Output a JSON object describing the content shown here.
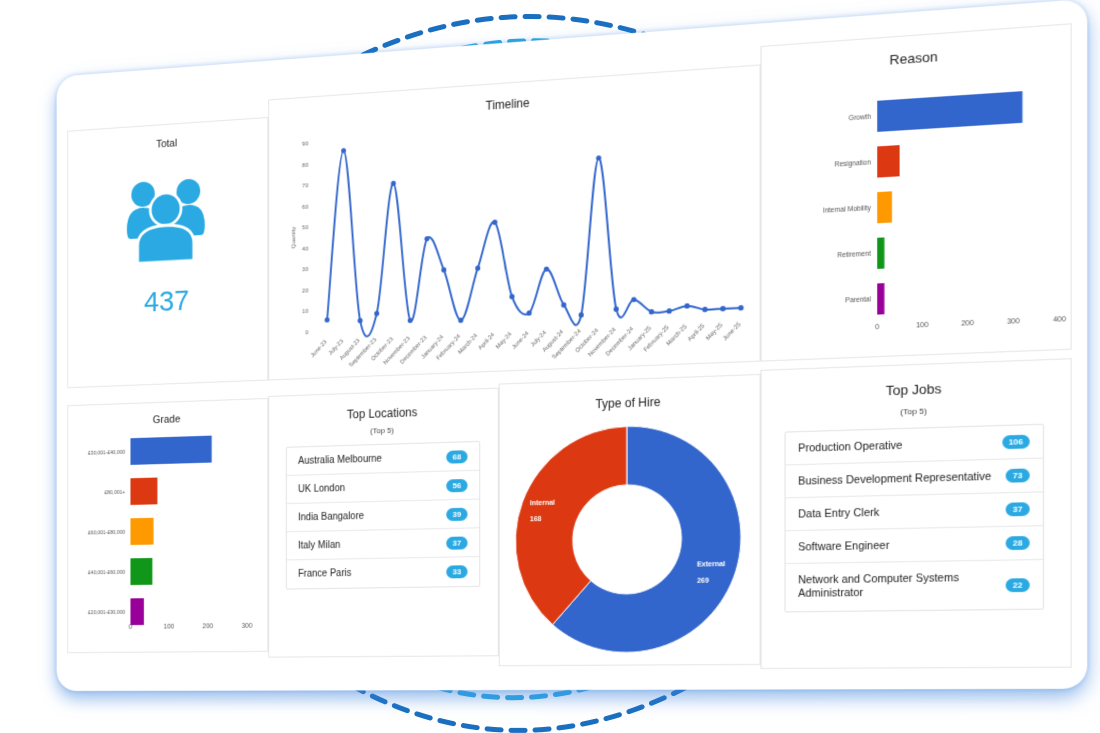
{
  "total": {
    "title": "Total",
    "value": "437",
    "icon": "users-group-icon",
    "color": "#2aa9e2"
  },
  "timeline": {
    "title": "Timeline",
    "chart_data": {
      "type": "line",
      "title": "Timeline",
      "xlabel": "",
      "ylabel": "Quantity",
      "ylim": [
        0,
        90
      ],
      "yticks": [
        0,
        10,
        20,
        30,
        40,
        50,
        60,
        70,
        80,
        90
      ],
      "grid": false,
      "color": "#3366cc",
      "x": [
        "June-23",
        "July-23",
        "August-23",
        "September-23",
        "October-23",
        "November-23",
        "December-23",
        "January-24",
        "February-24",
        "March-24",
        "April-24",
        "May-24",
        "June-24",
        "July-24",
        "August-24",
        "September-24",
        "October-24",
        "November-24",
        "December-24",
        "January-25",
        "February-25",
        "March-25",
        "April-25",
        "May-25",
        "June-25"
      ],
      "values": [
        5,
        85,
        4,
        7,
        68,
        3,
        41,
        26,
        2,
        26,
        47,
        12,
        4,
        24,
        7,
        2,
        74,
        4,
        8,
        2,
        2,
        4,
        2,
        2,
        2
      ]
    }
  },
  "reason": {
    "title": "Reason",
    "chart_data": {
      "type": "bar",
      "orientation": "horizontal",
      "title": "Reason",
      "categories": [
        "Growth",
        "Resignation",
        "Internal Mobility",
        "Retirement",
        "Parental"
      ],
      "values": [
        320,
        50,
        33,
        16,
        16
      ],
      "colors": [
        "#3366cc",
        "#dc3912",
        "#ff9900",
        "#109618",
        "#990099"
      ],
      "xlim": [
        0,
        400
      ],
      "xticks": [
        0,
        100,
        200,
        300,
        400
      ]
    }
  },
  "grade": {
    "title": "Grade",
    "chart_data": {
      "type": "bar",
      "orientation": "horizontal",
      "title": "Grade",
      "categories": [
        "£30,001-£40,000",
        "£80,001+",
        "£60,001-£80,000",
        "£40,001-£60,000",
        "£20,001-£30,000"
      ],
      "values": [
        210,
        70,
        60,
        57,
        35
      ],
      "colors": [
        "#3366cc",
        "#dc3912",
        "#ff9900",
        "#109618",
        "#990099"
      ],
      "xlim": [
        0,
        300
      ],
      "xticks": [
        0,
        100,
        200,
        300
      ]
    }
  },
  "locations": {
    "title": "Top Locations",
    "subtitle": "(Top 5)",
    "items": [
      {
        "label": "Australia Melbourne",
        "count": "68"
      },
      {
        "label": "UK London",
        "count": "56"
      },
      {
        "label": "India Bangalore",
        "count": "39"
      },
      {
        "label": "Italy Milan",
        "count": "37"
      },
      {
        "label": "France Paris",
        "count": "33"
      }
    ]
  },
  "hire": {
    "title": "Type of Hire",
    "chart_data": {
      "type": "pie",
      "title": "Type of Hire",
      "donut": true,
      "slices": [
        {
          "label": "External",
          "value": 269,
          "color": "#3366cc"
        },
        {
          "label": "Internal",
          "value": 168,
          "color": "#dc3912"
        }
      ]
    }
  },
  "jobs": {
    "title": "Top Jobs",
    "subtitle": "(Top 5)",
    "items": [
      {
        "label": "Production Operative",
        "count": "106"
      },
      {
        "label": "Business Development Representative",
        "count": "73"
      },
      {
        "label": "Data Entry Clerk",
        "count": "37"
      },
      {
        "label": "Software Engineer",
        "count": "28"
      },
      {
        "label": "Network and Computer Systems Administrator",
        "count": "22"
      }
    ]
  }
}
